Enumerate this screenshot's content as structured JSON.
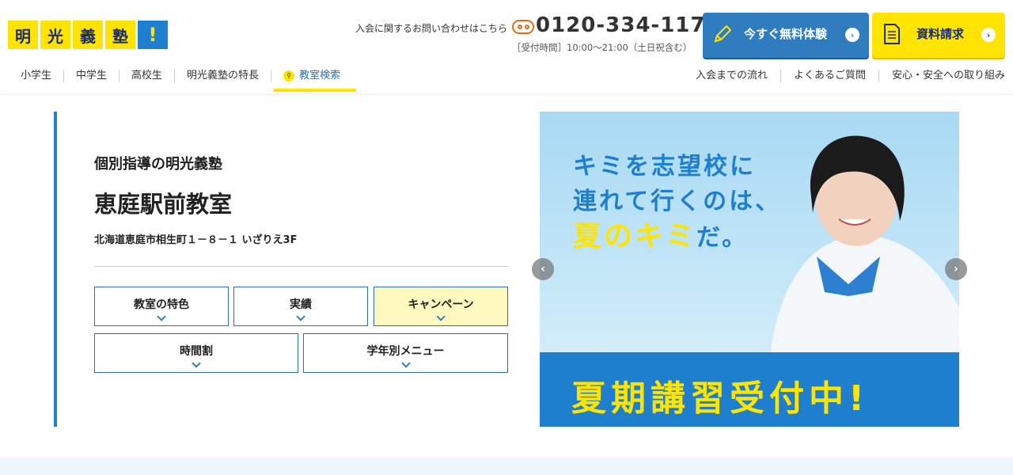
{
  "logo": {
    "chars": [
      "明",
      "光",
      "義",
      "塾"
    ],
    "mark": "!"
  },
  "header": {
    "inquiry_text": "入会に関するお問い合わせはこちら",
    "phone_number": "0120-334-117",
    "hours": "［受付時間］10:00〜21:00（土日祝含む）",
    "trial_button": "今すぐ無料体験",
    "request_button": "資料請求",
    "trial_icon": "pencil-icon",
    "request_icon": "document-icon",
    "phone_icon": "free-dial-icon",
    "arrow_glyph": "›"
  },
  "nav": {
    "left": [
      "小学生",
      "中学生",
      "高校生",
      "明光義塾の特長"
    ],
    "search": "教室検索",
    "right": [
      "入会までの流れ",
      "よくあるご質問",
      "安心・安全への取り組み"
    ]
  },
  "classroom": {
    "brand": "個別指導の明光義塾",
    "name": "恵庭駅前教室",
    "address": "北海道恵庭市相生町１－８－１ いざりえ3F",
    "tabs": [
      "教室の特色",
      "実績",
      "キャンペーン",
      "時間割",
      "学年別メニュー"
    ]
  },
  "banner": {
    "line1": "キミを志望校に",
    "line2": "連れて行くのは、",
    "line3_highlight": "夏のキミ",
    "line3_rest": "だ。",
    "strip": "夏期講習受付中!",
    "prev": "‹",
    "next": "›"
  },
  "colors": {
    "brand_blue": "#1f7fcf",
    "brand_yellow": "#ffe400",
    "navy": "#1b2a6b"
  }
}
